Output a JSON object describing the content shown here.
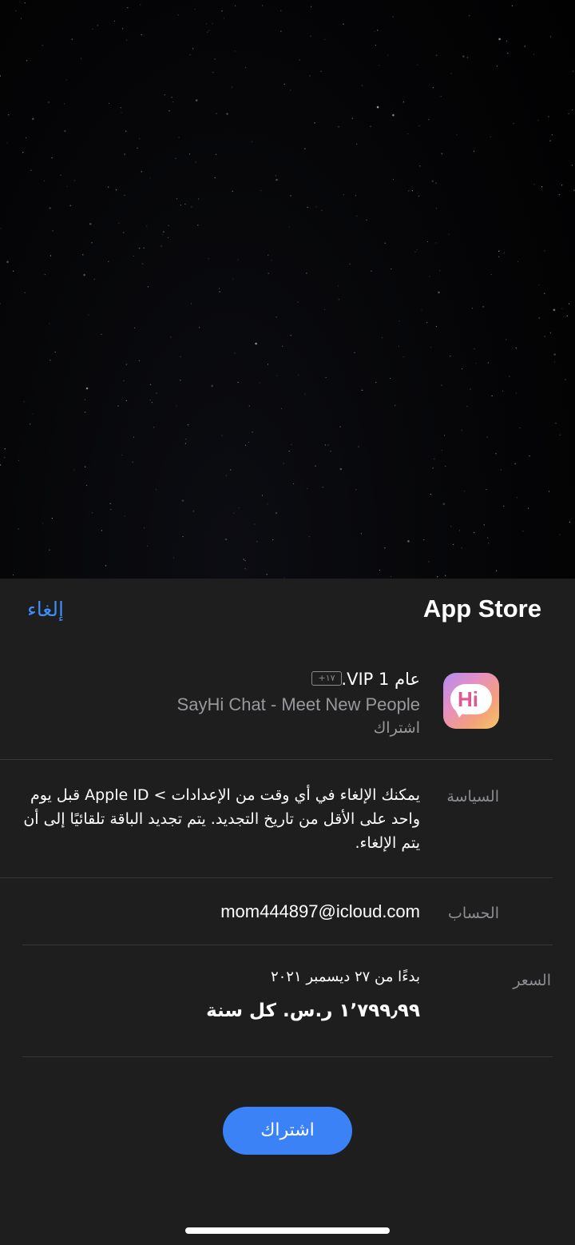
{
  "sheet": {
    "title": "App Store",
    "cancel_label": "إلغاء"
  },
  "app": {
    "subscription_name": "عام 1 VIP.",
    "age_rating": "+١٧",
    "name": "SayHi Chat - Meet New People",
    "kind": "اشتراك",
    "icon_text": "Hi",
    "icon": "sayhi-app-icon"
  },
  "policy": {
    "label": "السياسة",
    "text": "يمكنك الإلغاء في أي وقت من الإعدادات > Apple ID قبل يوم واحد على الأقل من تاريخ التجديد. يتم تجديد الباقة تلقائيًا إلى أن يتم الإلغاء."
  },
  "account": {
    "label": "الحساب",
    "value": "mom444897@icloud.com"
  },
  "price": {
    "label": "السعر",
    "start_text": "بدءًا من ٢٧ ديسمبر ٢٠٢١",
    "value_text": "١٬٧٩٩٫٩٩ ر.س. كل سنة"
  },
  "subscribe_label": "اشتراك",
  "colors": {
    "accent": "#3a82f6",
    "sheet_background": "#1e1e1f",
    "secondary_text": "#98989d"
  }
}
